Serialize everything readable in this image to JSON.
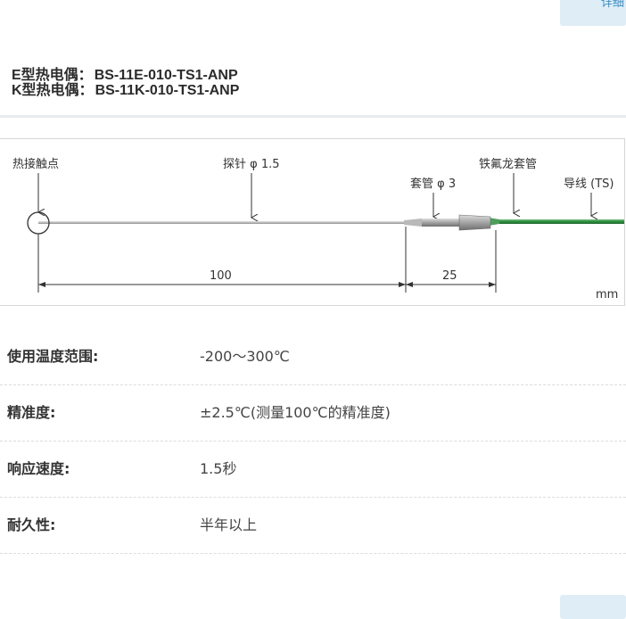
{
  "top_tab": {
    "label": "详细"
  },
  "models": [
    {
      "type_label": "E型热电偶：",
      "code": "BS-11E-010-TS1-ANP"
    },
    {
      "type_label": "K型热电偶：",
      "code": "BS-11K-010-TS1-ANP"
    }
  ],
  "diagram": {
    "hot_junction": "热接触点",
    "probe": "探针 φ 1.5",
    "sleeve": "套管 φ 3",
    "teflon_sleeve": "铁氟龙套管",
    "lead_wire": "导线 (TS)",
    "dim_probe": "100",
    "dim_sleeve": "25",
    "unit": "mm",
    "colors": {
      "lead_wire": "#2f8a3e",
      "probe": "#b5b5b5",
      "sleeve": "#9a9a9a"
    }
  },
  "specs": [
    {
      "label": "使用温度范围:",
      "value": "-200～300℃"
    },
    {
      "label": "精准度:",
      "value": "±2.5℃(测量100℃的精准度)"
    },
    {
      "label": "响应速度:",
      "value": "1.5秒"
    },
    {
      "label": "耐久性:",
      "value": "半年以上"
    }
  ]
}
